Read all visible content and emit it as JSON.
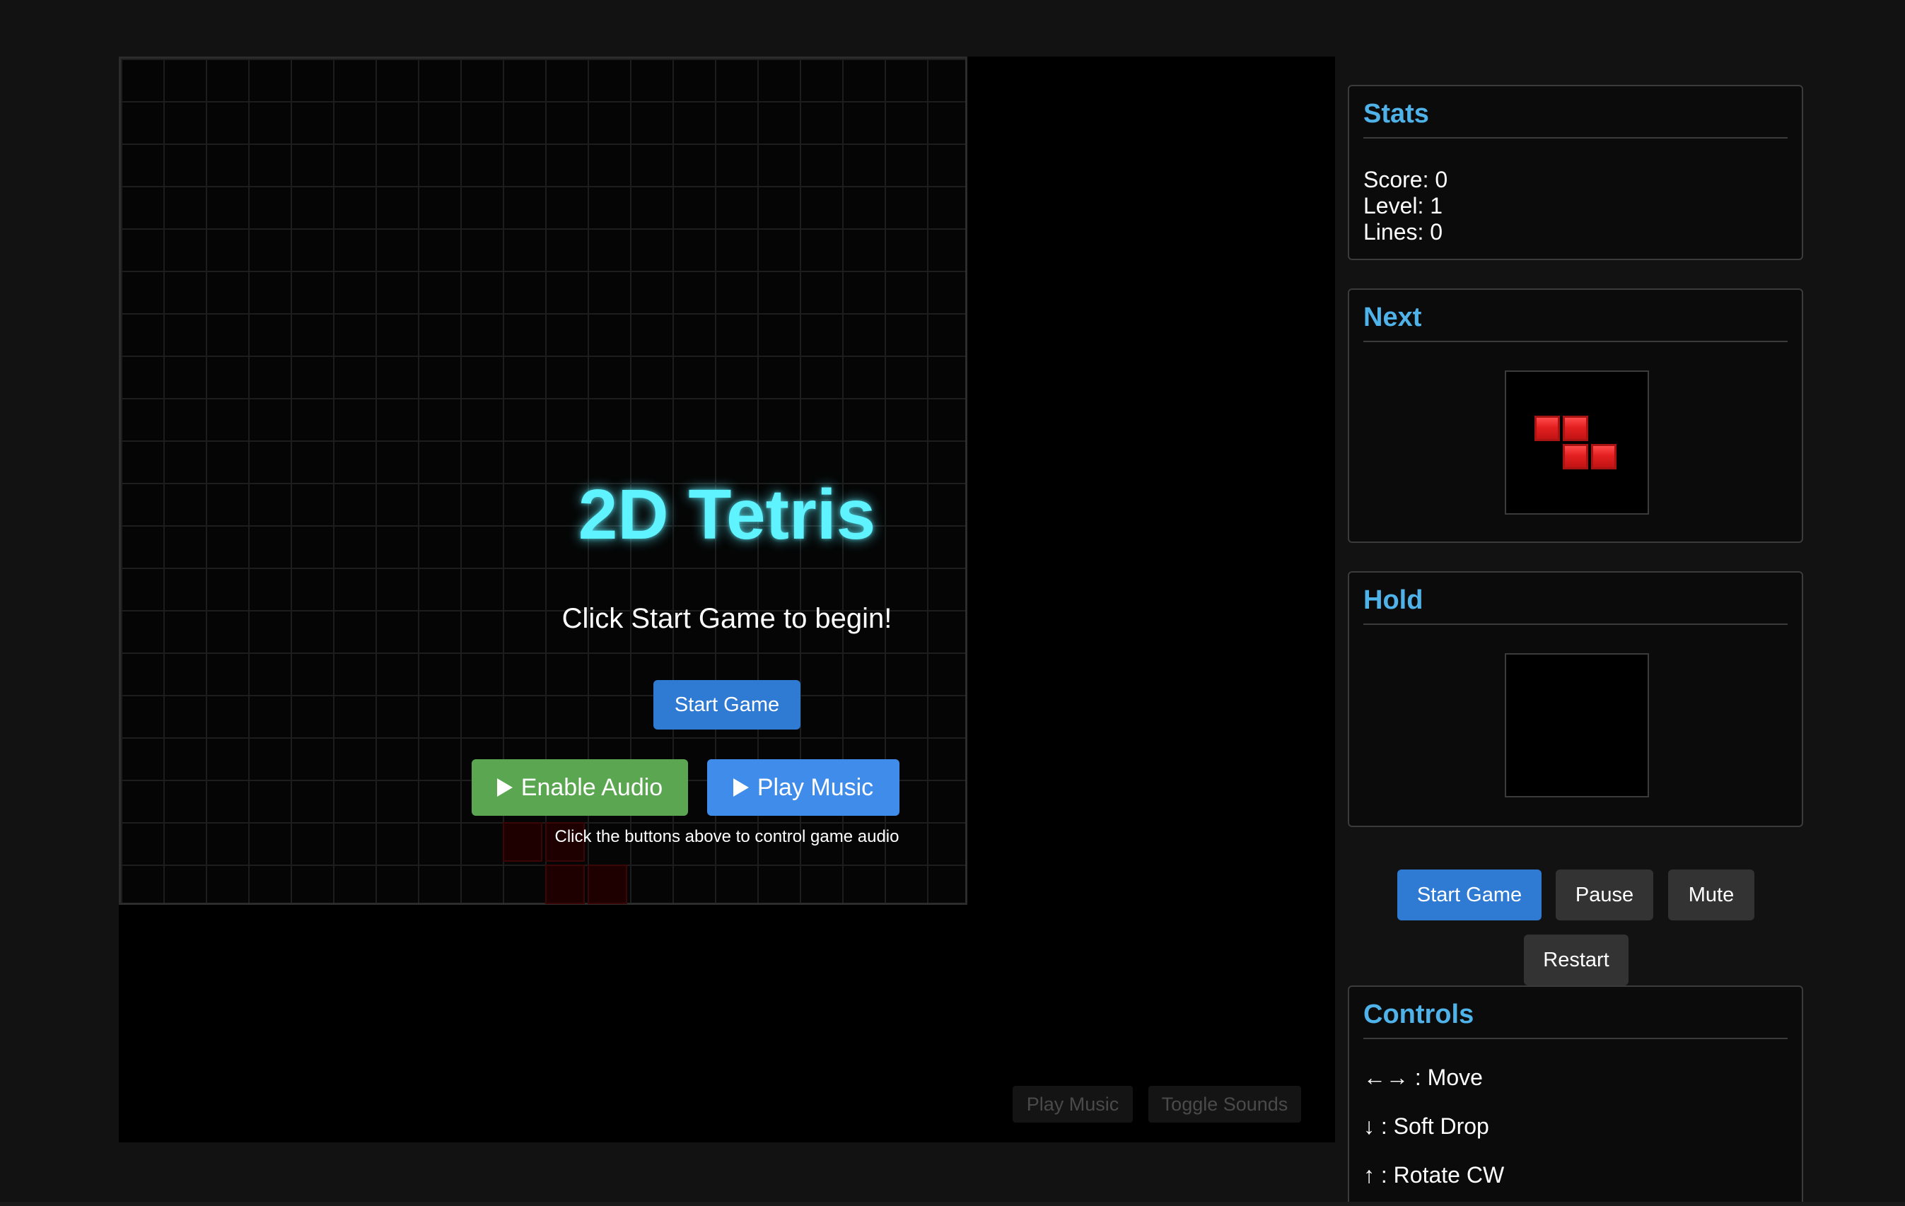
{
  "game": {
    "title": "2D Tetris",
    "subtitle": "Click Start Game to begin!",
    "start_button": "Start Game",
    "enable_audio_button": "Enable Audio",
    "play_music_button": "Play Music",
    "audio_hint": "Click the buttons above to control game audio",
    "secondary_buttons": {
      "play_music": "Play Music",
      "toggle_sounds": "Toggle Sounds"
    }
  },
  "sidebar": {
    "stats": {
      "title": "Stats",
      "score": "Score: 0",
      "level": "Level: 1",
      "lines": "Lines: 0"
    },
    "next": {
      "title": "Next",
      "piece": "Z"
    },
    "hold": {
      "title": "Hold",
      "piece": ""
    },
    "buttons": {
      "start": "Start Game",
      "pause": "Pause",
      "mute": "Mute",
      "restart": "Restart"
    },
    "controls": {
      "title": "Controls",
      "items": [
        "←→ : Move",
        "↓ : Soft Drop",
        "↑ : Rotate CW"
      ]
    }
  },
  "colors": {
    "title_glow": "#5ff2ff",
    "accent_blue": "#2f7bd4",
    "audio_green": "#5aa651",
    "panel_heading": "#4fb3ea",
    "piece_red": "#e42020"
  }
}
